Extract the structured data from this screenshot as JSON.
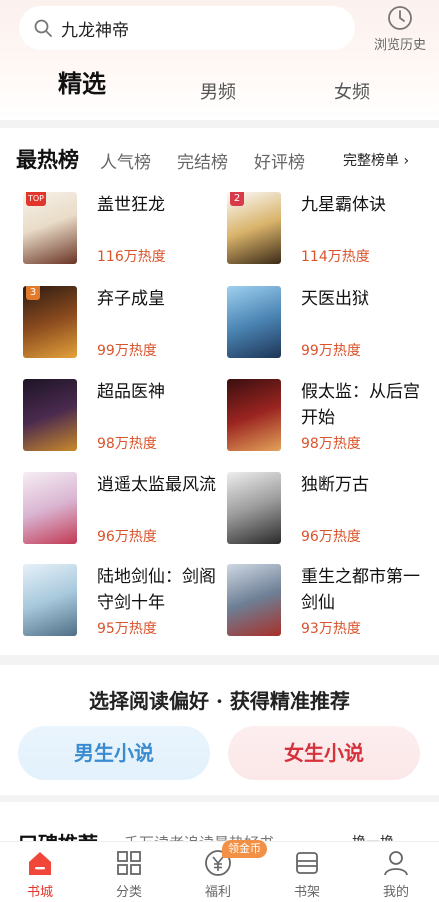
{
  "search": {
    "query": "九龙神帝"
  },
  "history": {
    "label": "浏览历史"
  },
  "tabs": [
    {
      "label": "精选",
      "active": true
    },
    {
      "label": "男频",
      "active": false
    },
    {
      "label": "女频",
      "active": false
    }
  ],
  "ranking": {
    "title": "最热榜",
    "tabs": [
      "人气榜",
      "完结榜",
      "好评榜"
    ],
    "more_label": "完整榜单 ›",
    "books": [
      {
        "title": "盖世狂龙",
        "heat": "116万热度",
        "rank_badge": "TOP"
      },
      {
        "title": "九星霸体诀",
        "heat": "114万热度",
        "rank_badge": "2"
      },
      {
        "title": "弃子成皇",
        "heat": "99万热度",
        "rank_badge": "3"
      },
      {
        "title": "天医出狱",
        "heat": "99万热度",
        "rank_badge": ""
      },
      {
        "title": "超品医神",
        "heat": "98万热度",
        "rank_badge": ""
      },
      {
        "title": "假太监：从后宫开始",
        "heat": "98万热度",
        "rank_badge": ""
      },
      {
        "title": "逍遥太监最风流",
        "heat": "96万热度",
        "rank_badge": ""
      },
      {
        "title": "独断万古",
        "heat": "96万热度",
        "rank_badge": ""
      },
      {
        "title": "陆地剑仙：剑阁守剑十年",
        "heat": "95万热度",
        "rank_badge": ""
      },
      {
        "title": "重生之都市第一剑仙",
        "heat": "93万热度",
        "rank_badge": ""
      }
    ]
  },
  "preference": {
    "title": "选择阅读偏好 · 获得精准推荐",
    "male_label": "男生小说",
    "female_label": "女生小说"
  },
  "next_section": {
    "title": "口碑推荐",
    "subtitle": "千万读者追读最热好书",
    "refresh_label": "换一换"
  },
  "nav": {
    "items": [
      {
        "label": "书城",
        "icon": "home-icon",
        "active": true
      },
      {
        "label": "分类",
        "icon": "grid-icon",
        "active": false
      },
      {
        "label": "福利",
        "icon": "coin-icon",
        "active": false
      },
      {
        "label": "书架",
        "icon": "bookshelf-icon",
        "active": false
      },
      {
        "label": "我的",
        "icon": "profile-icon",
        "active": false
      }
    ],
    "coin_badge": "领金币"
  },
  "colors": {
    "accent": "#e2362c",
    "heat": "#d9532b",
    "male": "#3a8bd0",
    "female": "#d6323b"
  }
}
